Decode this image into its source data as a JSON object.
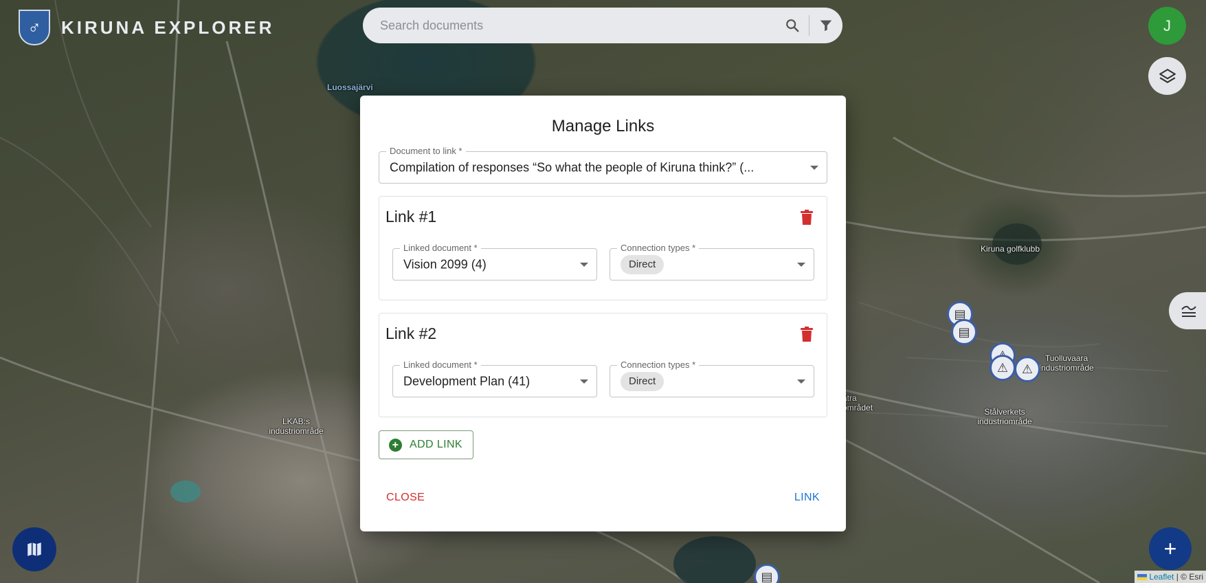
{
  "header": {
    "app_title": "KIRUNA EXPLORER",
    "search": {
      "placeholder": "Search documents"
    },
    "user_initial": "J"
  },
  "map": {
    "labels": [
      {
        "text": "Luossajärvi"
      },
      {
        "text": "Kiruna golfklubb"
      },
      {
        "text": "Tuolluvaara industriområde"
      },
      {
        "text": "Stålverkets industriområde"
      },
      {
        "text": "LKAB:s industriområde"
      },
      {
        "text": "atra området"
      }
    ],
    "attribution": {
      "leaflet": "Leaflet",
      "separator": "|",
      "esri": "© Esri"
    }
  },
  "modal": {
    "title": "Manage Links",
    "document_to_link": {
      "label": "Document to link *",
      "value": "Compilation of responses “So what the people of Kiruna think?” (..."
    },
    "links": [
      {
        "title": "Link #1",
        "linked_document_label": "Linked document *",
        "linked_document_value": "Vision 2099 (4)",
        "connection_types_label": "Connection types *",
        "connection_type_chip": "Direct"
      },
      {
        "title": "Link #2",
        "linked_document_label": "Linked document *",
        "linked_document_value": "Development Plan (41)",
        "connection_types_label": "Connection types *",
        "connection_type_chip": "Direct"
      }
    ],
    "add_link_label": "ADD LINK",
    "close_label": "CLOSE",
    "link_label": "LINK"
  },
  "colors": {
    "accent_green": "#2e7d32",
    "danger_red": "#d32f2f",
    "primary_blue": "#1976d2",
    "avatar_green": "#2e9a3a",
    "fab_blue": "#123a86"
  }
}
